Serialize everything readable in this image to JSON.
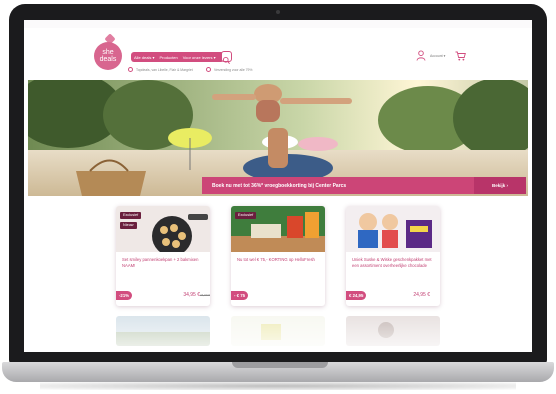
{
  "logo": {
    "text_line1": "she",
    "text_line2": "deals"
  },
  "nav": {
    "items": [
      "Alle deals ▾",
      "Producten",
      "Voor onze lezers ▾"
    ]
  },
  "usps": [
    "Topdeals, van Libelle, Flair & Margriet",
    "Verzending voor alle 79%"
  ],
  "header": {
    "account_label": "Account ▾"
  },
  "hero": {
    "banner_text": "Boek nu met tot 36%* vroegboekkorting bij Center Parcs",
    "banner_button": "Bekijk ›"
  },
  "products": [
    {
      "tags": [
        "Exclusief",
        "Nieuw"
      ],
      "title": "Set smiley pannenkoekpan + 2 bakmixen NAAM!",
      "badge": "-21%",
      "price": "34,95 €",
      "old_price": "44,00 €"
    },
    {
      "tags": [
        "Exclusief"
      ],
      "title": "Nu tot wel € 75,- KORTING op HelloFresh",
      "badge": "- € 75",
      "price": "",
      "old_price": ""
    },
    {
      "tags": [],
      "title": "Uniek Suske & Wiske geschenkpakket met een assortiment overheerlijke chocolade",
      "badge": "€ 24,95",
      "price": "24,95 €",
      "old_price": ""
    }
  ],
  "colors": {
    "brand": "#d24d7f",
    "brand_dark": "#b83469",
    "tag_dark": "#6a1f3d"
  }
}
